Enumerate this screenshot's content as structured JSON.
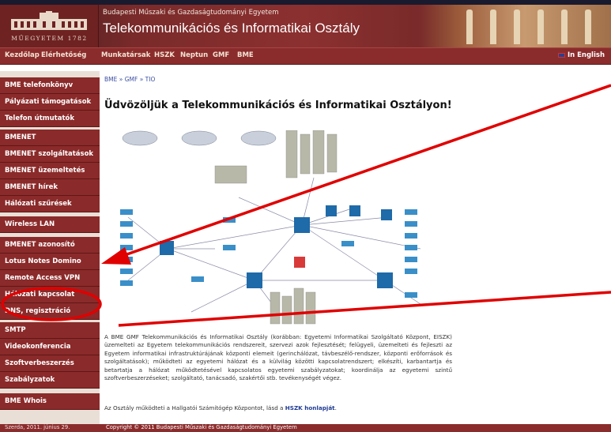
{
  "header": {
    "logo_text": "MŰEGYETEM 1782",
    "subtitle": "Budapesti Műszaki és Gazdaságtudományi Egyetem",
    "title": "Telekommunikációs és Informatikai Osztály"
  },
  "nav": {
    "items": [
      "Kezdőlap",
      "Elérhetőség",
      "Munkatársak",
      "HSZK",
      "Neptun",
      "GMF",
      "BME"
    ],
    "english": "In English"
  },
  "sidebar": {
    "items": [
      "BME telefonkönyv",
      "Pályázati támogatások",
      "Telefon útmutatók",
      "BMENET",
      "BMENET szolgáltatások",
      "BMENET üzemeltetés",
      "BMENET hírek",
      "Hálózati szűrések",
      "Wireless LAN",
      "BMENET azonosító",
      "Lotus Notes Domino",
      "Remote Access VPN",
      "Hálózati kapcsolat",
      "DNS, regisztráció",
      "SMTP",
      "Videokonferencia",
      "Szoftverbeszerzés",
      "Szabályzatok",
      "BME Whois"
    ]
  },
  "content": {
    "breadcrumb": "BME » GMF » TIO",
    "title": "Üdvözöljük a Telekommunikációs és Informatikai Osztályon!",
    "paragraph1": "A BME GMF Telekommunikációs és Informatikai Osztály (korábban: Egyetemi Informatikai Szolgáltató Központ, EISZK) üzemelteti az Egyetem telekommunikációs rendszereit, szervezi azok fejlesztését; felügyeli, üzemelteti és fejleszti az Egyetem informatikai infrastruktúrájának központi elemeit (gerinchálózat, távbeszélő-rendszer, központi erőforrások és szolgáltatások); működteti az egyetemi hálózat és a külvilág közötti kapcsolatrendszert; elkészíti, karbantartja és betartatja a hálózat működtetésével kapcsolatos egyetemi szabályzatokat; koordinálja az egyetemi szintű szoftverbeszerzéseket; szolgáltató, tanácsadó, szakértői stb. tevékenységét végez.",
    "paragraph2_prefix": "Az Osztály működteti a Hallgatói Számítógép Központot, lásd a",
    "paragraph2_link": "HSZK honlapját",
    "paragraph2_suffix": "."
  },
  "footer": {
    "date": "Szerda, 2011. június 29.",
    "copyright": "Copyright © 2011 Budapesti Műszaki és Gazdaságtudományi Egyetem"
  },
  "colors": {
    "brand": "#8b2c2c",
    "annotation": "#e00000"
  }
}
